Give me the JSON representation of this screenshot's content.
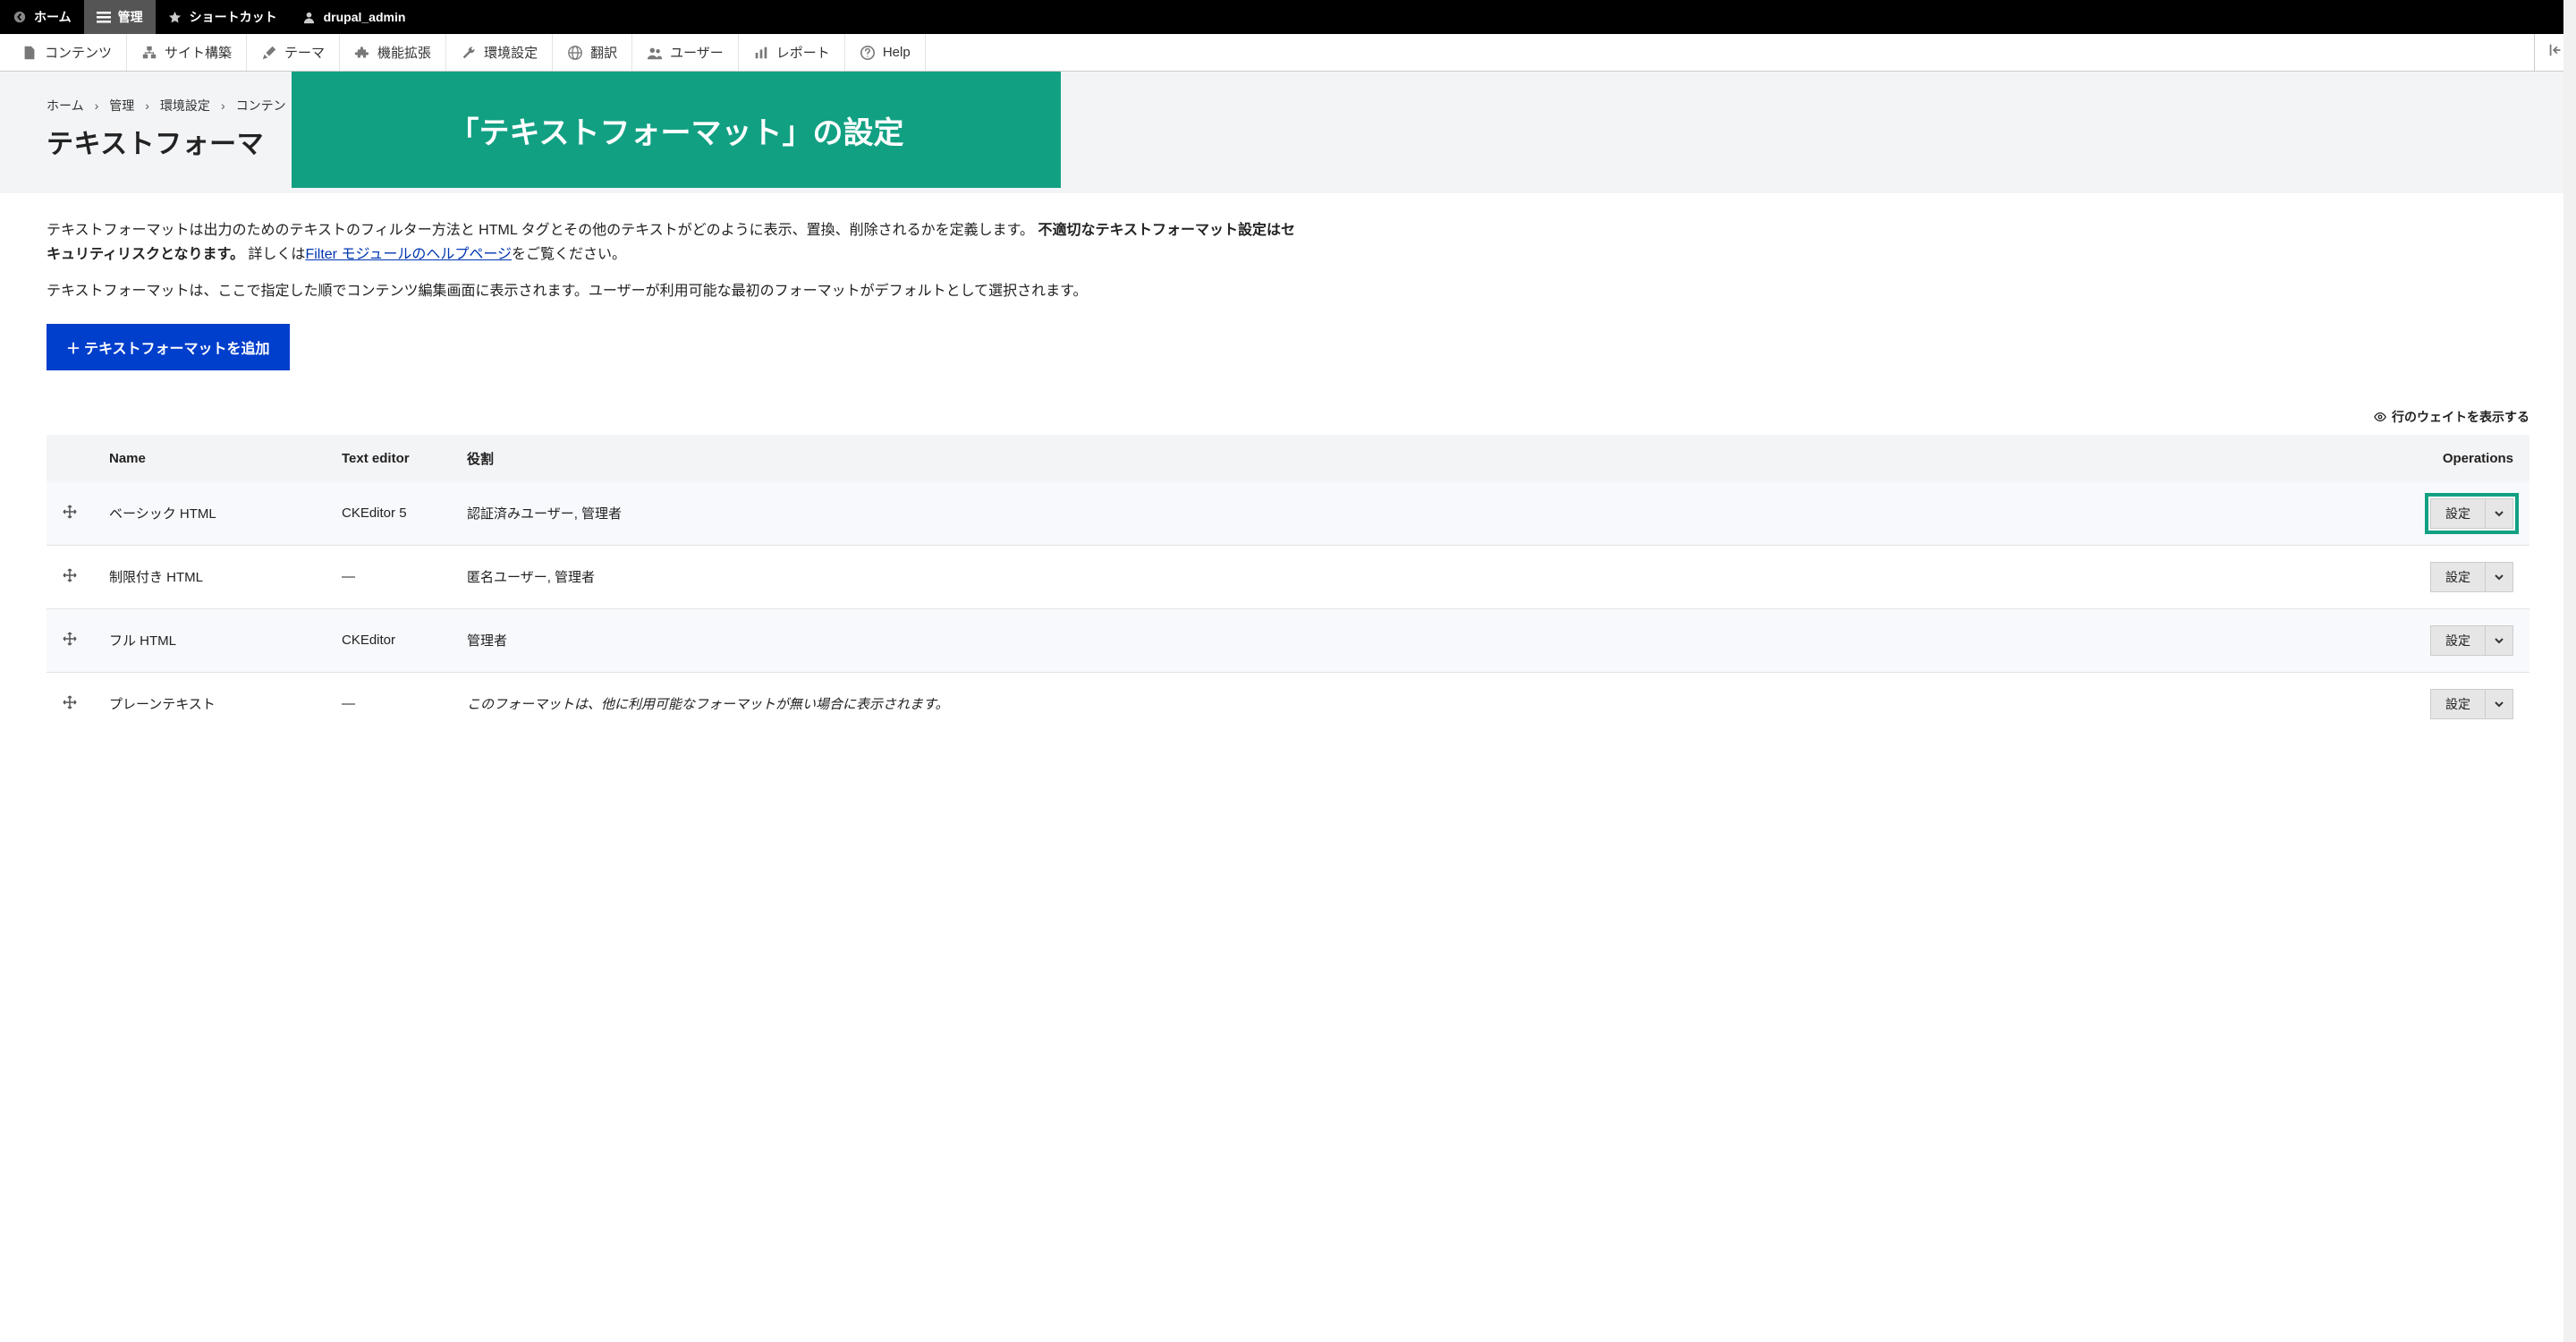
{
  "topbar": {
    "home": "ホーム",
    "manage": "管理",
    "shortcuts": "ショートカット",
    "user": "drupal_admin"
  },
  "adminmenu": {
    "content": "コンテンツ",
    "structure": "サイト構築",
    "appearance": "テーマ",
    "extend": "機能拡張",
    "config": "環境設定",
    "translate": "翻訳",
    "people": "ユーザー",
    "reports": "レポート",
    "help": "Help"
  },
  "breadcrumb": {
    "home": "ホーム",
    "manage": "管理",
    "config": "環境設定",
    "content": "コンテン"
  },
  "page": {
    "title": "テキストフォーマ",
    "banner": "「テキストフォーマット」の設定",
    "desc1_a": "テキストフォーマットは出力のためのテキストのフィルター方法と HTML タグとその他のテキストがどのように表示、置換、削除されるかを定義します。",
    "desc1_strong": "不適切なテキストフォーマット設定はセキュリティリスクとなります。",
    "desc1_b": "詳しくは",
    "desc1_link": "Filter モジュールのヘルプページ",
    "desc1_c": "をご覧ください。",
    "desc2": "テキストフォーマットは、ここで指定した順でコンテンツ編集画面に表示されます。ユーザーが利用可能な最初のフォーマットがデフォルトとして選択されます。",
    "add_button": "テキストフォーマットを追加",
    "show_weights": "行のウェイトを表示する"
  },
  "table": {
    "headers": {
      "name": "Name",
      "editor": "Text editor",
      "roles": "役割",
      "operations": "Operations"
    },
    "rows": [
      {
        "name": "ベーシック HTML",
        "editor": "CKEditor 5",
        "roles": "認証済みユーザー, 管理者",
        "italic": false,
        "highlight": true
      },
      {
        "name": "制限付き HTML",
        "editor": "—",
        "roles": "匿名ユーザー, 管理者",
        "italic": false,
        "highlight": false
      },
      {
        "name": "フル HTML",
        "editor": "CKEditor",
        "roles": "管理者",
        "italic": false,
        "highlight": false
      },
      {
        "name": "プレーンテキスト",
        "editor": "—",
        "roles": "このフォーマットは、他に利用可能なフォーマットが無い場合に表示されます。",
        "italic": true,
        "highlight": false
      }
    ],
    "op_label": "設定"
  }
}
